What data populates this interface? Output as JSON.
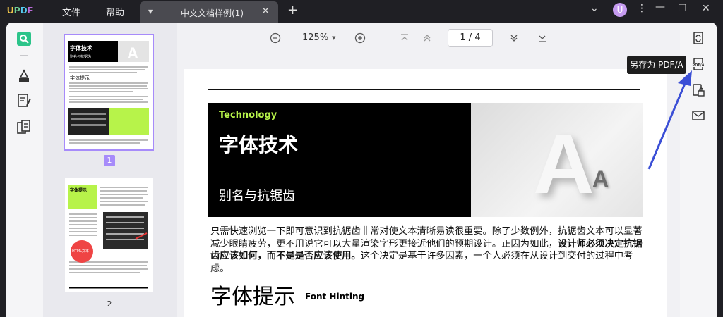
{
  "app": {
    "logo_text": [
      "U",
      "P",
      "D",
      "F"
    ]
  },
  "menu": {
    "file": "文件",
    "help": "帮助"
  },
  "tab": {
    "title": "中文文档样例(1)",
    "close": "✕",
    "add": "+"
  },
  "user": {
    "avatar_letter": "U"
  },
  "toolbar": {
    "zoom": "125%",
    "page_current": "1",
    "page_sep": "/",
    "page_total": "4"
  },
  "thumbnails": [
    {
      "page": "1"
    },
    {
      "page": "2"
    }
  ],
  "doc": {
    "banner_kicker": "Technology",
    "banner_title": "字体技术",
    "banner_subtitle": "别名与抗锯齿",
    "para_1": "只需快速浏览一下即可意识到抗锯齿非常对使文本清晰易读很重要。除了少数例外，抗锯齿文本可以显著减少眼睛疲劳，更不用说它可以大量渲染字形更接近他们的预期设计。正因为如此，",
    "para_bold": "设计师必须决定抗锯齿应该如何，而不是是否应该使用。",
    "para_2": "这个决定是基于许多因素，一个人必须在从设计到交付的过程中考虑。",
    "heading": "字体提示",
    "heading_en": "Font Hinting"
  },
  "thumb1": {
    "title": "字体技术",
    "sub": "别名与抗锯齿",
    "hint": "字体提示"
  },
  "thumb2": {
    "title": "字体提示",
    "html_label": "HTML文本"
  },
  "tooltip": {
    "text": "另存为 PDF/A"
  },
  "colors": {
    "accent": "#a78bfa",
    "lime": "#b7f34a",
    "arrow": "#3b4fd6"
  }
}
